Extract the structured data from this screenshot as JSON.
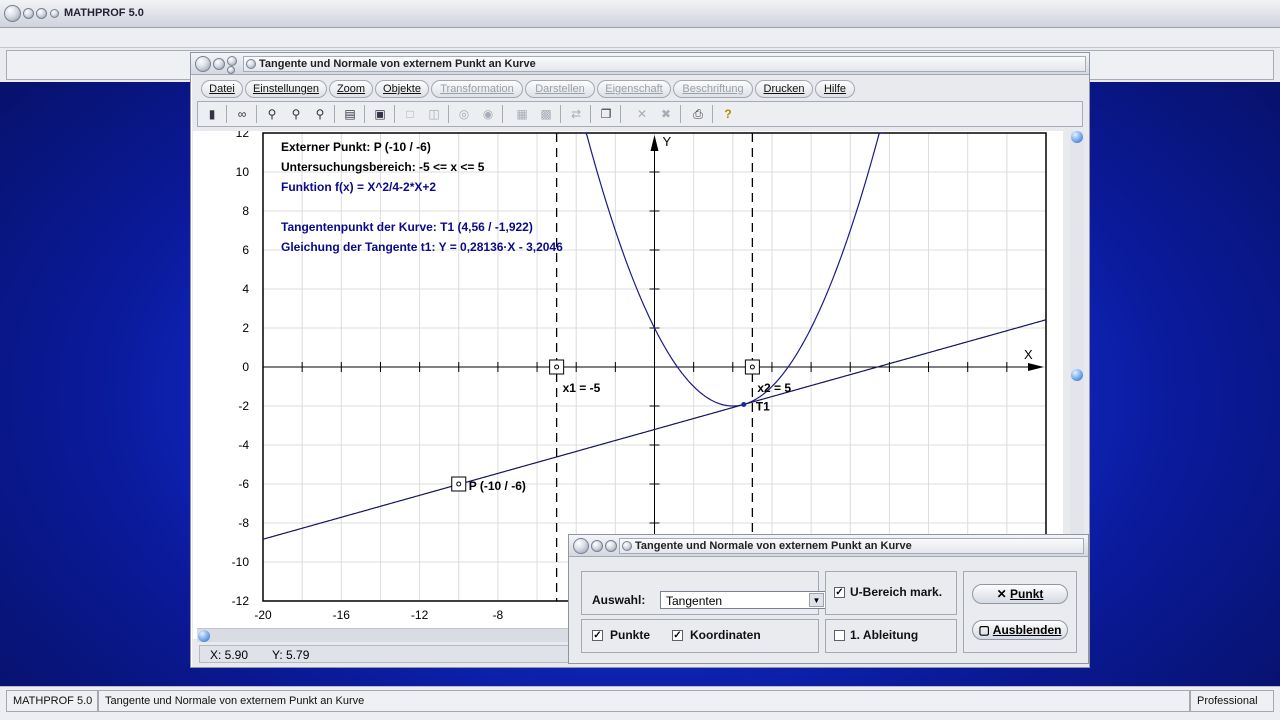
{
  "app": {
    "title": "MATHPROF 5.0"
  },
  "window": {
    "title": "Tangente und Normale von externem Punkt an Kurve",
    "menu": [
      {
        "label": "Datei",
        "enabled": true
      },
      {
        "label": "Einstellungen",
        "enabled": true
      },
      {
        "label": "Zoom",
        "enabled": true
      },
      {
        "label": "Objekte",
        "enabled": true
      },
      {
        "label": "Transformation",
        "enabled": false
      },
      {
        "label": "Darstellen",
        "enabled": false
      },
      {
        "label": "Eigenschaft",
        "enabled": false
      },
      {
        "label": "Beschriftung",
        "enabled": false
      },
      {
        "label": "Drucken",
        "enabled": true
      },
      {
        "label": "Hilfe",
        "enabled": true
      }
    ],
    "toolbar_icons": [
      "calculator-icon",
      "glasses-icon",
      "zoom-out-icon",
      "zoom-icon",
      "zoom-in-icon",
      "properties-icon",
      "window-icon",
      "box-icon",
      "double-box-icon",
      "circle-icon",
      "circle-dot-icon",
      "table-icon",
      "grid-icon",
      "export-icon",
      "copy-icon",
      "cross-icon",
      "double-cross-icon",
      "print-icon",
      "help-icon"
    ]
  },
  "plot": {
    "info_lines": [
      {
        "text": "Externer Punkt: P (-10 / -6)",
        "color": "#000000"
      },
      {
        "text": "Untersuchungsbereich: -5 <= x <= 5",
        "color": "#000000"
      },
      {
        "text": "Funktion f(x) = X^2/4-2*X+2",
        "color": "#0a0a8c"
      },
      {
        "text": "Tangentenpunkt der Kurve: T1 (4,56 / -1,922)",
        "color": "#0a0a8c"
      },
      {
        "text": "Gleichung der Tangente t1: Y = 0,28136·X - 3,2046",
        "color": "#0a0a8c"
      }
    ],
    "axis_x_label": "X",
    "axis_y_label": "Y",
    "labels": {
      "x1": "x1 = -5",
      "x2": "x2 = 5",
      "t1": "T1",
      "p": "P (-10 / -6)"
    },
    "curve_color": "#1a1a8a"
  },
  "chart_data": {
    "type": "line",
    "title": "",
    "xlabel": "X",
    "ylabel": "Y",
    "xlim": [
      -20,
      20
    ],
    "ylim": [
      -12,
      12
    ],
    "x_ticks": [
      -20,
      -16,
      -12,
      -8
    ],
    "y_ticks": [
      12,
      10,
      8,
      6,
      4,
      2,
      0,
      -2,
      -4,
      -6,
      -8,
      -10,
      -12
    ],
    "grid": true,
    "series": [
      {
        "name": "f(x) = X^2/4-2*X+2",
        "function": "x*x/4-2*x+2"
      },
      {
        "name": "t1: Y = 0,28136·X - 3,2046",
        "function": "0.28136*x-3.2046"
      }
    ],
    "points": [
      {
        "name": "P",
        "x": -10,
        "y": -6
      },
      {
        "name": "T1",
        "x": 4.56,
        "y": -1.922
      },
      {
        "name": "x1",
        "x": -5,
        "y": 0
      },
      {
        "name": "x2",
        "x": 5,
        "y": 0
      }
    ],
    "vertical_lines": [
      -5,
      5
    ]
  },
  "coords": {
    "x": "X: 5.90",
    "y": "Y: 5.79"
  },
  "dialog": {
    "title": "Tangente und Normale von externem Punkt an Kurve",
    "auswahl_label": "Auswahl:",
    "auswahl_value": "Tangenten",
    "ubereich_label": "U-Bereich mark.",
    "ubereich_checked": true,
    "punkte_label": "Punkte",
    "punkte_checked": true,
    "koordinaten_label": "Koordinaten",
    "koordinaten_checked": true,
    "ableitung_label": "1. Ableitung",
    "ableitung_checked": false,
    "punkt_button": "Punkt",
    "ausblenden_button": "Ausblenden"
  },
  "statusbar": {
    "app": "MATHPROF 5.0",
    "module": "Tangente und Normale von externem Punkt an Kurve",
    "edition": "Professional"
  }
}
